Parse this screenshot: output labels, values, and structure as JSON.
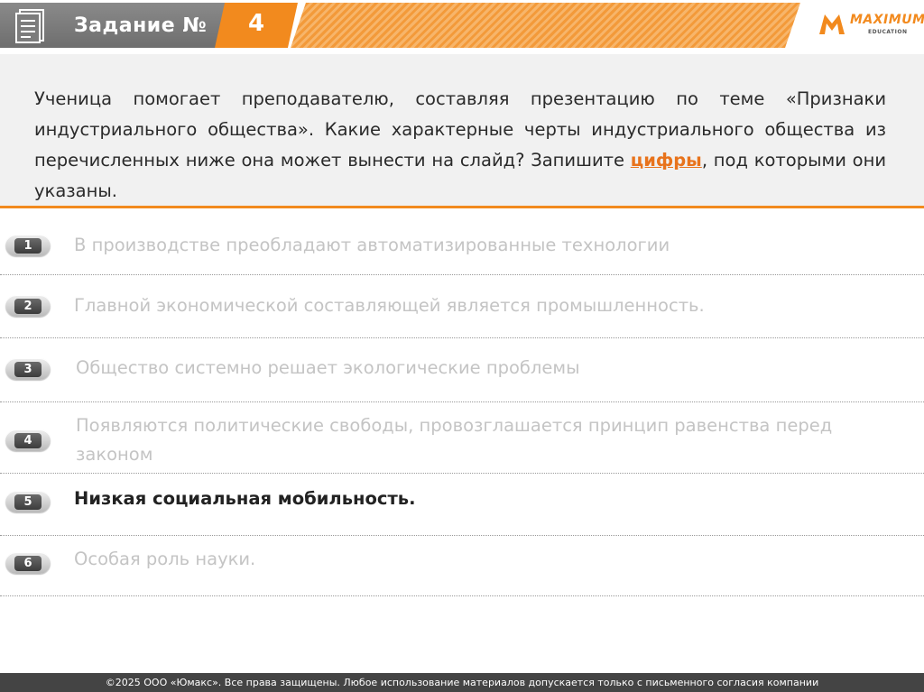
{
  "header": {
    "title": "Задание №",
    "task_number": "4",
    "logo": {
      "name": "MAXIMUM",
      "sub": "EDUCATION"
    },
    "colors": {
      "accent": "#f28a1e",
      "gray": "#7a7a7a"
    }
  },
  "question": {
    "part1": "Ученица помогает преподавателю, составляя презентацию по теме «Признаки индустриального общества». Какие характерные черты индустриального общества из перечисленных ниже она может вынести на слайд? Запишите ",
    "highlight": "цифры",
    "part2": ", под которыми они указаны."
  },
  "options": [
    {
      "number": "1",
      "text": "В производстве преобладают автоматизированные технологии",
      "active": false
    },
    {
      "number": "2",
      "text": "Главной экономической составляющей является промышленность.",
      "active": false
    },
    {
      "number": "3",
      "text": "Общество системно решает экологические проблемы",
      "active": false
    },
    {
      "number": "4",
      "text": "Появляются политические свободы, провозглашается принцип равенства перед законом",
      "active": false
    },
    {
      "number": "5",
      "text": "Низкая социальная мобильность.",
      "active": true
    },
    {
      "number": "6",
      "text": "Особая роль науки.",
      "active": false
    }
  ],
  "footer": {
    "copyright": "©2025 ООО «Юмакс». Все права защищены. Любое использование материалов допускается только с  письменного согласия компании"
  }
}
